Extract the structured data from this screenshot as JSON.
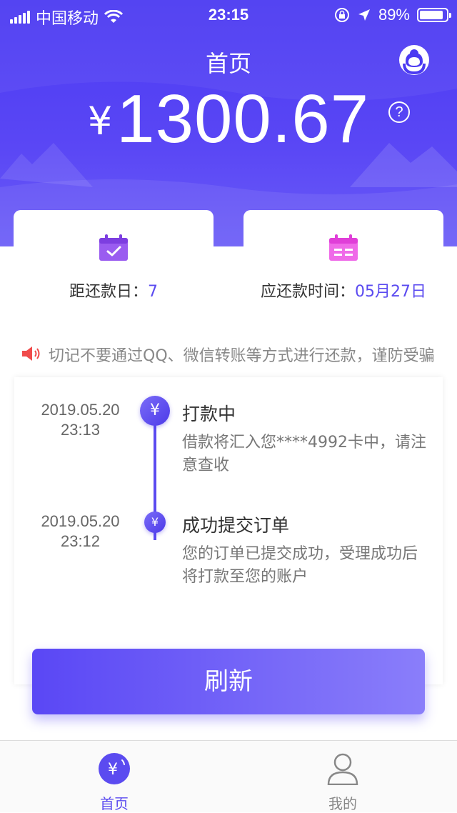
{
  "status_bar": {
    "carrier": "中国移动",
    "time": "23:15",
    "battery_percent": "89%",
    "battery_level": 0.89
  },
  "header": {
    "title": "首页",
    "currency_symbol": "¥",
    "amount": "1300.67",
    "help_symbol": "?"
  },
  "cards": {
    "left": {
      "label": "距还款日：",
      "value": "7"
    },
    "right": {
      "label": "应还款时间：",
      "value": "05月27日"
    }
  },
  "notice": {
    "text": "切记不要通过QQ、微信转账等方式进行还款，谨防受骗"
  },
  "timeline": [
    {
      "date": "2019.05.20",
      "time": "23:13",
      "title": "打款中",
      "desc": "借款将汇入您****4992卡中，请注意查收",
      "dot_symbol": "¥"
    },
    {
      "date": "2019.05.20",
      "time": "23:12",
      "title": "成功提交订单",
      "desc": "您的订单已提交成功，受理成功后将打款至您的账户",
      "dot_symbol": "¥"
    }
  ],
  "refresh_button": {
    "label": "刷新"
  },
  "tabbar": {
    "home": {
      "label": "首页",
      "icon": "yen-coin-icon"
    },
    "me": {
      "label": "我的",
      "icon": "user-icon"
    }
  },
  "colors": {
    "primary": "#5b4bf0",
    "header_bg": "#4b3af2",
    "card_icon_left": "#9a5cf0",
    "card_icon_right": "#e55cf0",
    "notice_icon": "#f04b4b"
  }
}
